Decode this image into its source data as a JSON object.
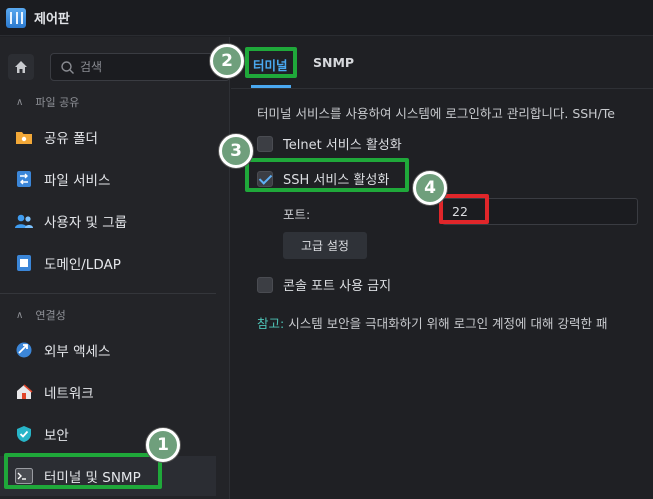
{
  "window": {
    "title": "제어판"
  },
  "sidebar": {
    "search_placeholder": "검색",
    "sections": [
      {
        "label": "파일 공유"
      },
      {
        "label": "연결성"
      }
    ],
    "items": [
      {
        "label": "공유 폴더",
        "icon": "shared-folder-icon"
      },
      {
        "label": "파일 서비스",
        "icon": "file-services-icon"
      },
      {
        "label": "사용자 및 그룹",
        "icon": "users-icon"
      },
      {
        "label": "도메인/LDAP",
        "icon": "domain-icon"
      },
      {
        "label": "외부 액세스",
        "icon": "external-access-icon"
      },
      {
        "label": "네트워크",
        "icon": "network-icon"
      },
      {
        "label": "보안",
        "icon": "shield-icon"
      },
      {
        "label": "터미널 및 SNMP",
        "icon": "terminal-icon",
        "active": true
      }
    ]
  },
  "tabs": [
    {
      "label": "터미널",
      "active": true
    },
    {
      "label": "SNMP",
      "active": false
    }
  ],
  "content": {
    "description": "터미널 서비스를 사용하여 시스템에 로그인하고 관리합니다. SSH/Te",
    "telnet_label": "Telnet 서비스 활성화",
    "telnet_checked": false,
    "ssh_label": "SSH 서비스 활성화",
    "ssh_checked": true,
    "port_label": "포트:",
    "port_value": "22",
    "advanced_button": "고급 설정",
    "console_label": "콘솔 포트 사용 금지",
    "console_checked": false,
    "note_label": "참고:",
    "note_text": " 시스템 보안을 극대화하기 위해 로그인 계정에 대해 강력한 패"
  },
  "annotations": [
    "1",
    "2",
    "3",
    "4"
  ],
  "colors": {
    "accent": "#4aa8f0",
    "highlight_green": "#1fa83a",
    "highlight_red": "#e0262a",
    "note_label": "#4ec3b6"
  }
}
